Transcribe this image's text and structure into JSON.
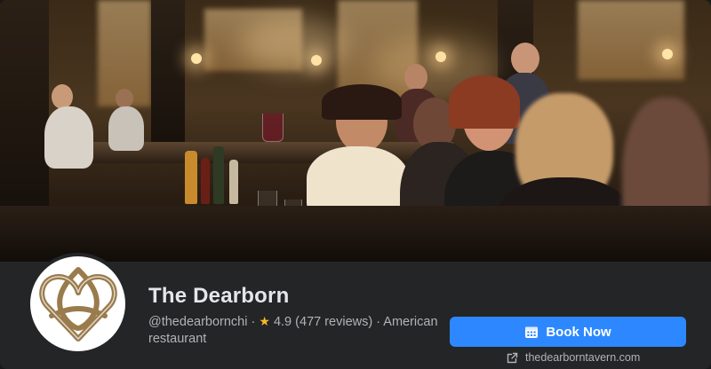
{
  "page": {
    "name": "The Dearborn",
    "handle": "@thedearbornchi",
    "separator": "·",
    "rating": "4.9",
    "reviews": "(477 reviews)",
    "category_line1": "· American",
    "category_line2": "restaurant"
  },
  "actions": {
    "book_label": "Book Now",
    "book_icon": "calendar-icon"
  },
  "website": {
    "url": "thedearborntavern.com",
    "icon": "external-link-icon"
  },
  "colors": {
    "background": "#242526",
    "primary_button": "#2d88ff",
    "title_text": "#e4e6eb",
    "secondary_text": "#b0b3b8",
    "star": "#f7b928",
    "logo_gold": "#9a7b4c"
  }
}
